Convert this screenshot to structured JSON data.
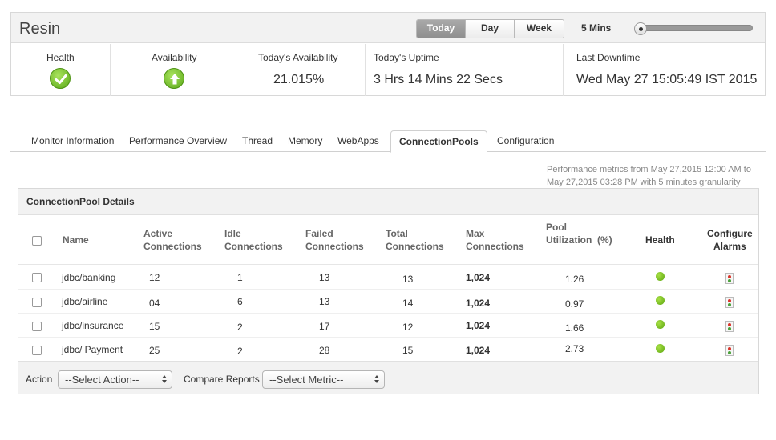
{
  "app": {
    "title": "Resin"
  },
  "time_range": {
    "buttons": [
      "Today",
      "Day",
      "Week"
    ],
    "selected": "Today",
    "interval_label": "5 Mins"
  },
  "summary": {
    "health_label": "Health",
    "availability_label": "Availability",
    "todays_availability_label": "Today's Availability",
    "todays_availability_value": "21.015%",
    "todays_uptime_label": "Today's Uptime",
    "todays_uptime_value": "3 Hrs 14 Mins 22 Secs",
    "last_downtime_label": "Last Downtime",
    "last_downtime_value": "Wed May 27 15:05:49 IST 2015"
  },
  "tabs": [
    "Monitor Information",
    "Performance Overview",
    "Thread",
    "Memory",
    "WebApps",
    "ConnectionPools",
    "Configuration"
  ],
  "active_tab": "ConnectionPools",
  "perf_note": {
    "line1": "Performance metrics from May 27,2015 12:00 AM to",
    "line2": "May 27,2015 03:28 PM with 5 minutes granularity"
  },
  "panel": {
    "title": "ConnectionPool Details",
    "columns": {
      "name": "Name",
      "active_1": "Active",
      "active_2": "Connections",
      "idle_1": "Idle",
      "idle_2": "Connections",
      "failed_1": "Failed",
      "failed_2": "Connections",
      "total_1": "Total",
      "total_2": "Connections",
      "max_1": "Max",
      "max_2": "Connections",
      "pool_1": "Pool",
      "pool_2": "Utilization  (%)",
      "health": "Health",
      "alarms_1": "Configure",
      "alarms_2": "Alarms"
    },
    "rows": [
      {
        "name": "jdbc/banking",
        "active": "12",
        "idle": "1",
        "failed": "13",
        "total": "13",
        "max": "1,024",
        "util": "1.26"
      },
      {
        "name": "jdbc/airline",
        "active": "04",
        "idle": "6",
        "failed": "13",
        "total": "14",
        "max": "1,024",
        "util": "0.97"
      },
      {
        "name": "jdbc/insurance",
        "active": "15",
        "idle": "2",
        "failed": "17",
        "total": "12",
        "max": "1,024",
        "util": "1.66"
      },
      {
        "name": "jdbc/ Payment",
        "active": "25",
        "idle": "2",
        "failed": "28",
        "total": "15",
        "max": "1,024",
        "util": "2.73"
      }
    ],
    "footer": {
      "action_label": "Action",
      "action_select": "--Select Action--",
      "compare_label": "Compare Reports",
      "compare_select": "--Select Metric--"
    }
  },
  "colors": {
    "health_ok": "#6cbf1f",
    "active_tab_border": "#d0d0d0",
    "active_range": "#9a9a9a"
  }
}
